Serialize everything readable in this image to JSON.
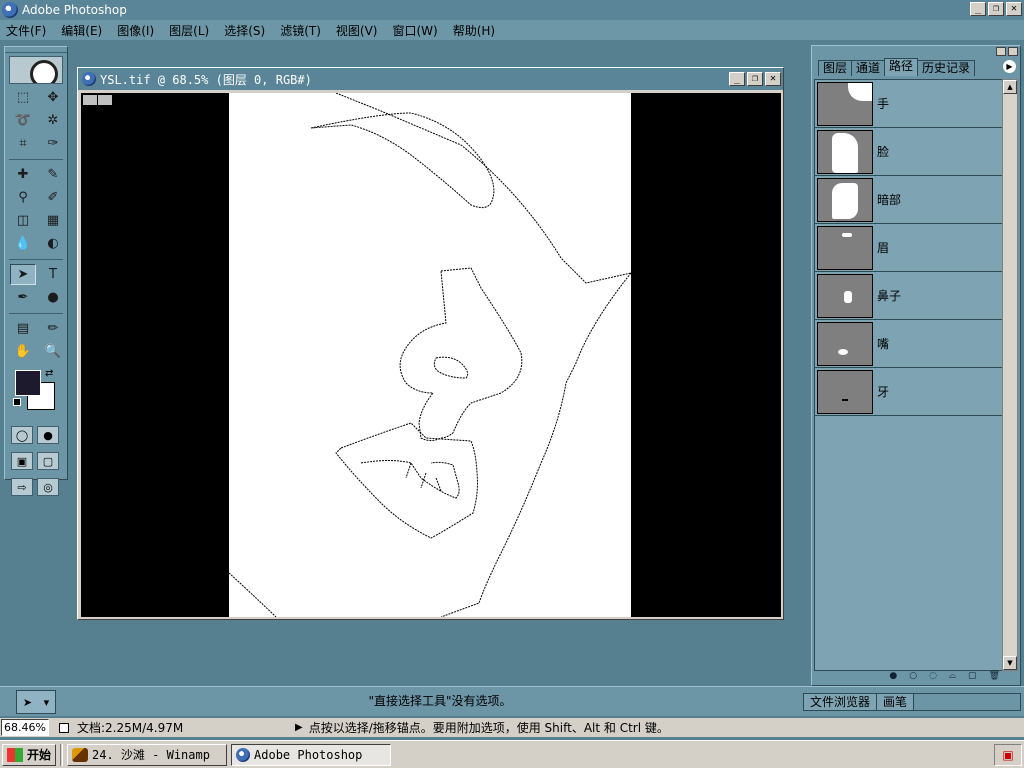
{
  "app": {
    "title": "Adobe Photoshop"
  },
  "window_controls": {
    "minimize": "_",
    "restore": "❐",
    "close": "✕"
  },
  "menu": [
    "文件(F)",
    "编辑(E)",
    "图像(I)",
    "图层(L)",
    "选择(S)",
    "滤镜(T)",
    "视图(V)",
    "窗口(W)",
    "帮助(H)"
  ],
  "document": {
    "title": "YSL.tif @ 68.5% (图层 0, RGB#)"
  },
  "palette": {
    "tabs": [
      "图层",
      "通道",
      "路径",
      "历史记录"
    ],
    "active_tab": "路径",
    "paths": [
      {
        "name": "手"
      },
      {
        "name": "脸"
      },
      {
        "name": "暗部"
      },
      {
        "name": "眉"
      },
      {
        "name": "鼻子"
      },
      {
        "name": "嘴"
      },
      {
        "name": "牙"
      }
    ]
  },
  "options": {
    "hint": "\"直接选择工具\"没有选项。"
  },
  "bottom_tabs": [
    "文件浏览器",
    "画笔"
  ],
  "status": {
    "zoom": "68.46%",
    "doc_size": "文档:2.25M/4.97M",
    "hint": "点按以选择/拖移锚点。要用附加选项，使用 Shift、Alt 和 Ctrl 键。"
  },
  "taskbar": {
    "start": "开始",
    "items": [
      "24. 沙滩 - Winamp",
      "Adobe Photoshop"
    ],
    "active_index": 1
  }
}
